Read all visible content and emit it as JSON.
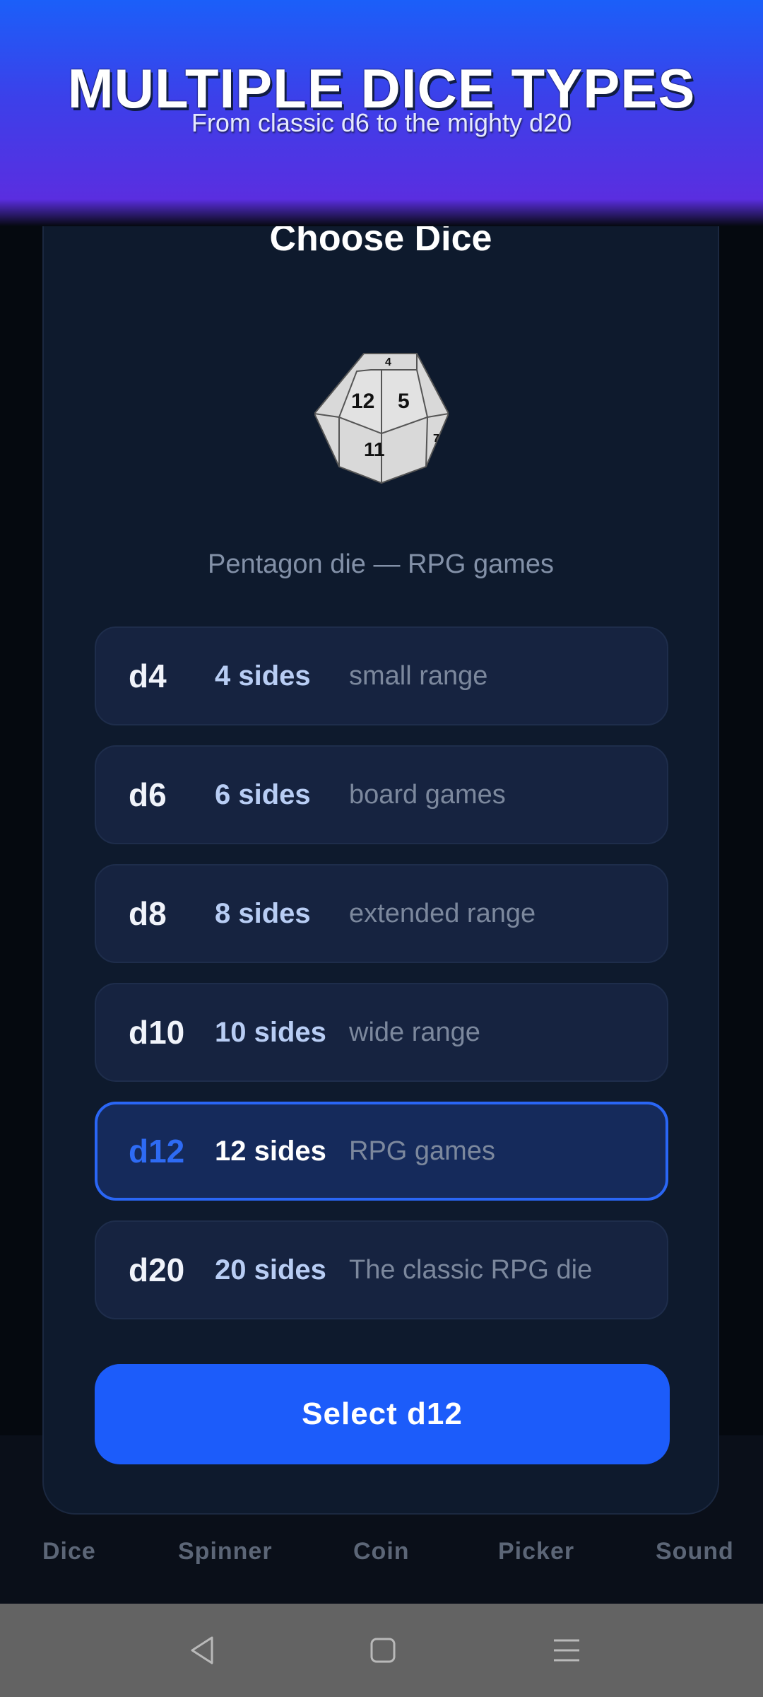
{
  "banner": {
    "title": "MULTIPLE DICE TYPES",
    "subtitle": "From classic d6 to the mighty d20"
  },
  "sheet": {
    "title": "Choose Dice",
    "preview": {
      "faces": [
        "12",
        "5",
        "11",
        "4",
        "7"
      ],
      "description": "Pentagon die — RPG games"
    },
    "options": [
      {
        "code": "d4",
        "sides": "4 sides",
        "note": "small range",
        "selected": false
      },
      {
        "code": "d6",
        "sides": "6 sides",
        "note": "board games",
        "selected": false
      },
      {
        "code": "d8",
        "sides": "8 sides",
        "note": "extended range",
        "selected": false
      },
      {
        "code": "d10",
        "sides": "10 sides",
        "note": "wide range",
        "selected": false
      },
      {
        "code": "d12",
        "sides": "12 sides",
        "note": "RPG games",
        "selected": true
      },
      {
        "code": "d20",
        "sides": "20 sides",
        "note": "The classic RPG die",
        "selected": false
      }
    ],
    "select_label": "Select d12"
  },
  "bottom_nav": {
    "tabs": [
      "Dice",
      "Spinner",
      "Coin",
      "Picker",
      "Sound"
    ]
  },
  "system_nav": {
    "icons": [
      "back-icon",
      "home-icon",
      "menu-icon"
    ]
  },
  "colors": {
    "accent": "#1c5cfa",
    "sheet_bg": "#0e1a2d",
    "selected_border": "#2a66f5"
  }
}
